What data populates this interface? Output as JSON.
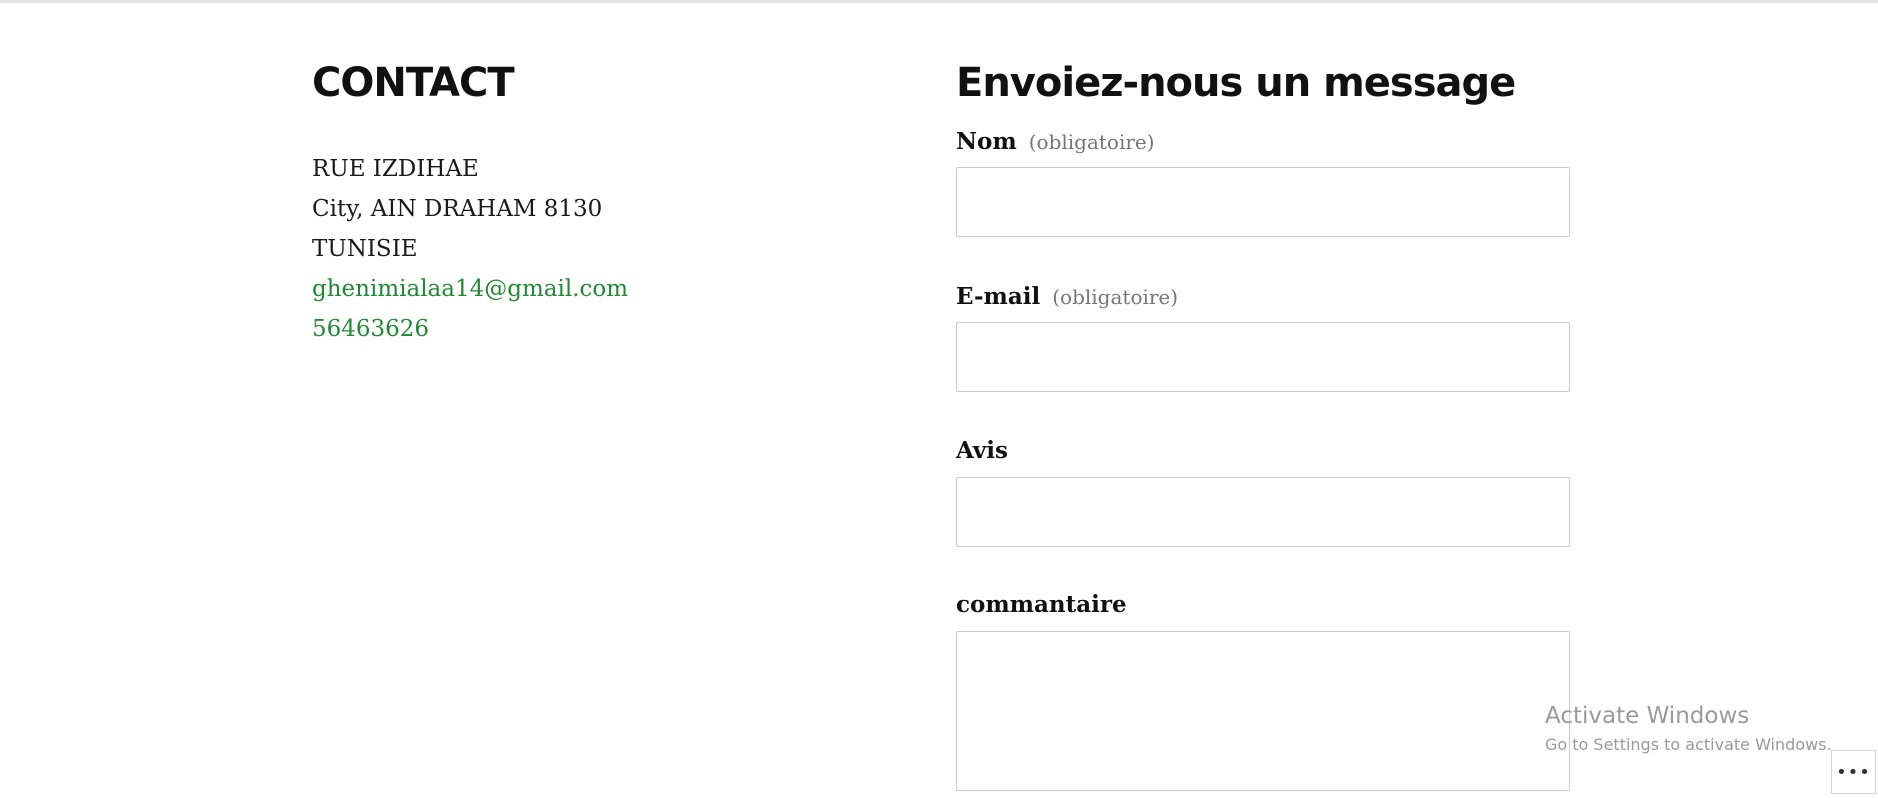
{
  "contact": {
    "title": "CONTACT",
    "address_line1": "RUE IZDIHAE",
    "address_line2": "City, AIN DRAHAM 8130",
    "country": "TUNISIE",
    "email": "ghenimialaa14@gmail.com",
    "phone": "56463626"
  },
  "form": {
    "title": "Envoiez-nous un message",
    "name_label": "Nom",
    "name_required": "(obligatoire)",
    "name_value": "",
    "email_label": "E-mail",
    "email_required": "(obligatoire)",
    "email_value": "",
    "avis_label": "Avis",
    "avis_value": "",
    "comment_label": "commantaire",
    "comment_value": ""
  },
  "watermark": {
    "title": "Activate Windows",
    "subtitle": "Go to Settings to activate Windows."
  },
  "more_button": {
    "label": "•••"
  },
  "colors": {
    "link": "#1f8a33",
    "border": "#cccccc",
    "muted": "#767676"
  }
}
